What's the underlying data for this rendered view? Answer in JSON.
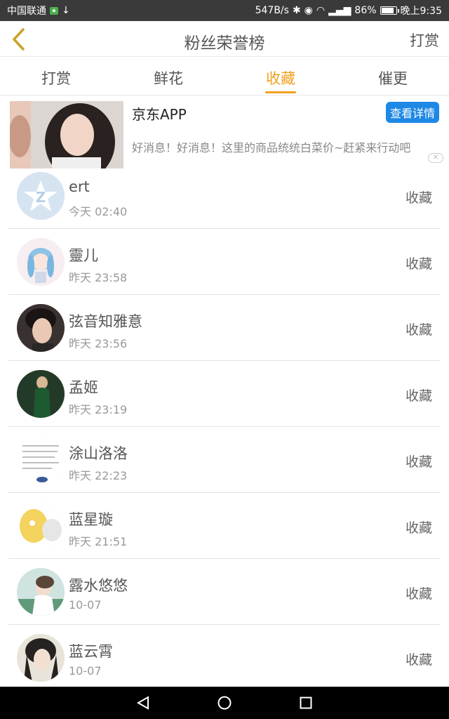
{
  "status_bar": {
    "carrier": "中国联通",
    "speed": "547B/s",
    "battery": "86%",
    "battery_level": 0.86,
    "time": "晚上9:35"
  },
  "header": {
    "title": "粉丝荣誉榜",
    "right_link": "打赏"
  },
  "tabs": [
    {
      "label": "打赏",
      "active": false
    },
    {
      "label": "鲜花",
      "active": false
    },
    {
      "label": "收藏",
      "active": true
    },
    {
      "label": "催更",
      "active": false
    }
  ],
  "ad": {
    "title": "京东APP",
    "button": "查看详情",
    "description": "好消息！好消息！这里的商品统统白菜价~赶紧来行动吧"
  },
  "fans": [
    {
      "name": "ert",
      "time": "今天 02:40",
      "action": "收藏"
    },
    {
      "name": "靈儿",
      "time": "昨天 23:58",
      "action": "收藏"
    },
    {
      "name": "弦音知雅意",
      "time": "昨天 23:56",
      "action": "收藏"
    },
    {
      "name": "孟姬",
      "time": "昨天 23:19",
      "action": "收藏"
    },
    {
      "name": "涂山洛洛",
      "time": "昨天 22:23",
      "action": "收藏"
    },
    {
      "name": "蓝星璇",
      "time": "昨天 21:51",
      "action": "收藏"
    },
    {
      "name": "露水悠悠",
      "time": "10-07",
      "action": "收藏"
    },
    {
      "name": "蓝云霄",
      "time": "10-07",
      "action": "收藏"
    }
  ],
  "colors": {
    "accent": "#f0a020",
    "ad_button": "#1e88e5",
    "status_bar": "#3a3a3a"
  }
}
